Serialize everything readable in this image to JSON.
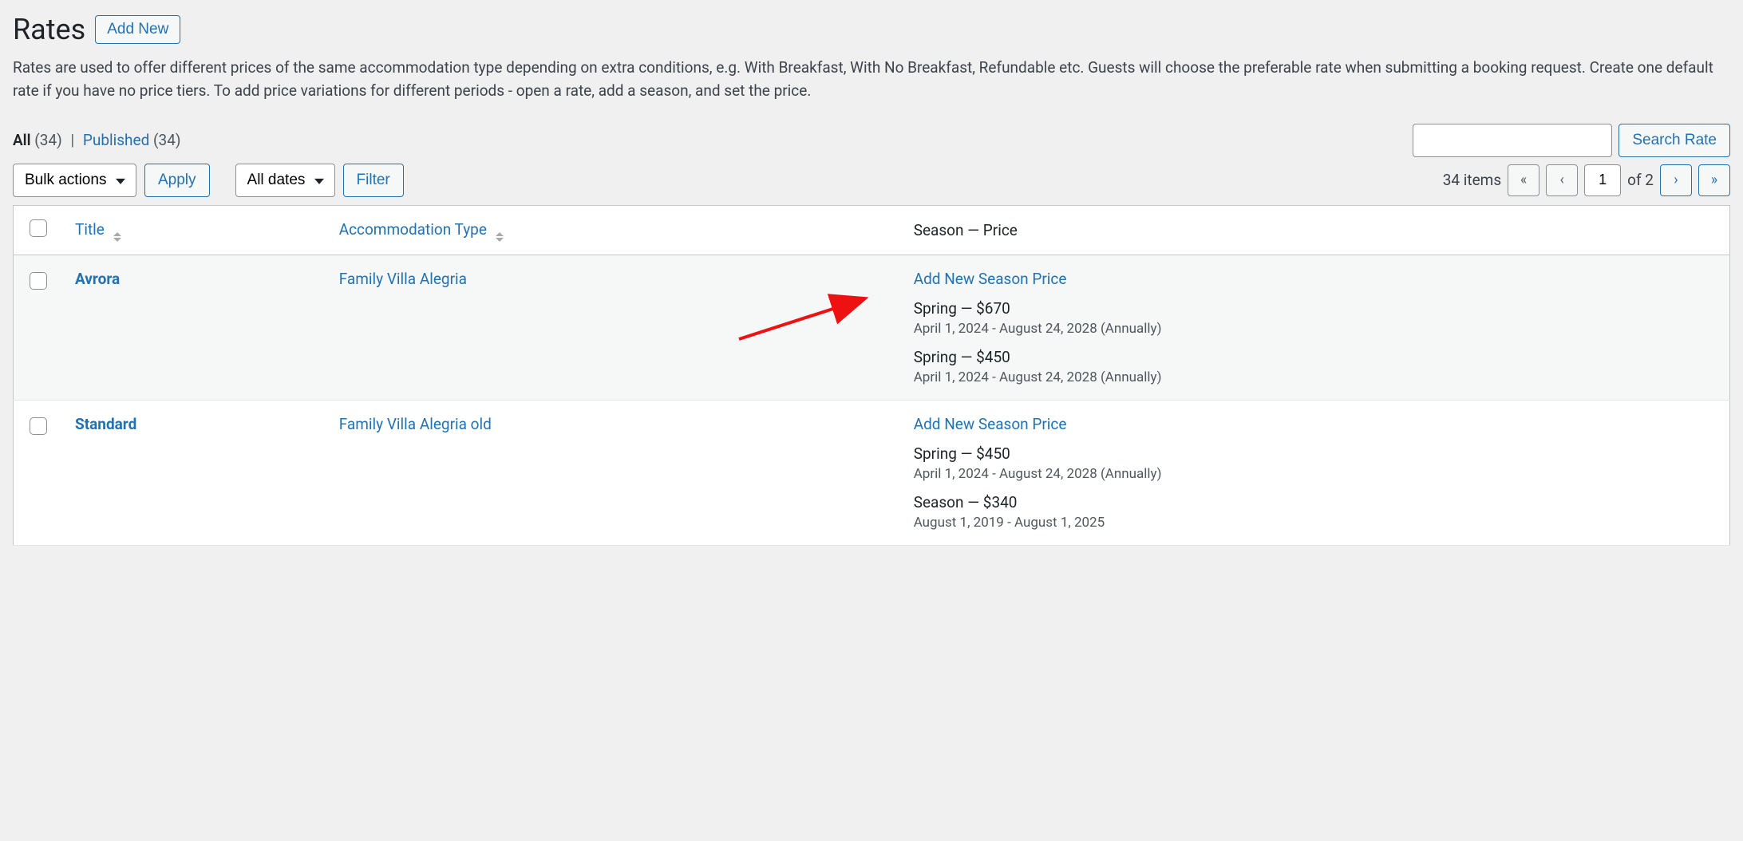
{
  "header": {
    "title": "Rates",
    "add_new_label": "Add New"
  },
  "description": "Rates are used to offer different prices of the same accommodation type depending on extra conditions, e.g. With Breakfast, With No Breakfast, Refundable etc. Guests will choose the preferable rate when submitting a booking request. Create one default rate if you have no price tiers. To add price variations for different periods - open a rate, add a season, and set the price.",
  "filters": {
    "all_label": "All",
    "all_count": "(34)",
    "published_label": "Published",
    "published_count": "(34)",
    "separator": "|"
  },
  "search": {
    "button_label": "Search Rate",
    "input_value": ""
  },
  "bulk": {
    "actions_label": "Bulk actions",
    "apply_label": "Apply",
    "dates_label": "All dates",
    "filter_label": "Filter"
  },
  "pagination": {
    "items_text": "34 items",
    "current": "1",
    "of_text": "of 2",
    "first": "«",
    "prev": "‹",
    "next": "›",
    "last": "»"
  },
  "columns": {
    "title": "Title",
    "accommodation": "Accommodation Type",
    "season_price": "Season — Price"
  },
  "rows": [
    {
      "title": "Avrora",
      "accommodation": "Family Villa Alegria",
      "add_label": "Add New Season Price",
      "seasons": [
        {
          "label": "Spring — $670",
          "dates": "April 1, 2024 - August 24, 2028 (Annually)"
        },
        {
          "label": "Spring — $450",
          "dates": "April 1, 2024 - August 24, 2028 (Annually)"
        }
      ]
    },
    {
      "title": "Standard",
      "accommodation": "Family Villa Alegria old",
      "add_label": "Add New Season Price",
      "seasons": [
        {
          "label": "Spring — $450",
          "dates": "April 1, 2024 - August 24, 2028 (Annually)"
        },
        {
          "label": "Season — $340",
          "dates": "August 1, 2019 - August 1, 2025"
        }
      ]
    }
  ]
}
